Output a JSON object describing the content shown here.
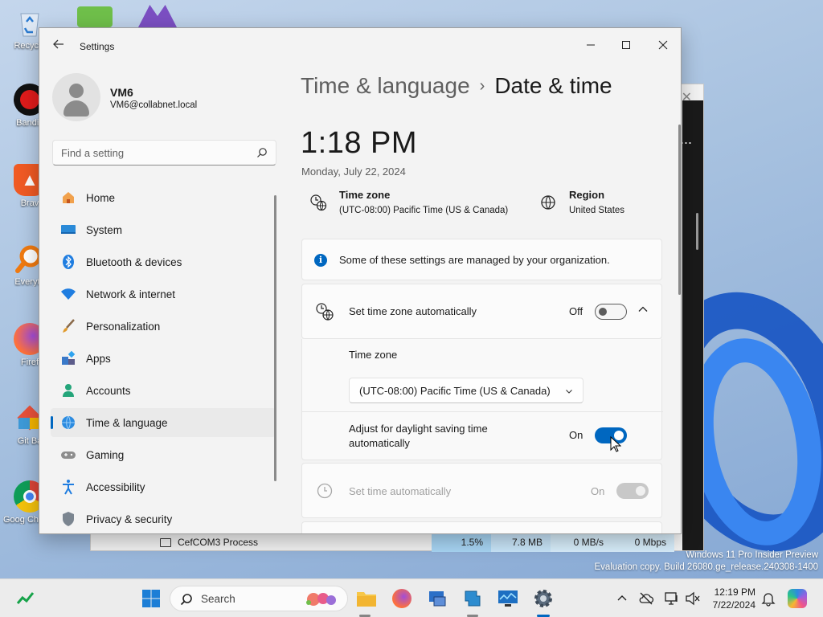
{
  "desktop": {
    "icons": [
      {
        "label": "Recycle",
        "icon": "recycle-bin-icon"
      },
      {
        "label": "Bandic",
        "icon": "bandicam-icon"
      },
      {
        "label": "Brav",
        "icon": "brave-browser-icon"
      },
      {
        "label": "Everyth",
        "icon": "everything-search-icon"
      },
      {
        "label": "Firef",
        "icon": "firefox-icon"
      },
      {
        "label": "Git Ba",
        "icon": "git-bash-icon"
      },
      {
        "label": "Goog Chrome",
        "icon": "google-chrome-icon"
      }
    ],
    "watermark": {
      "line1": "Windows 11 Pro Insider Preview",
      "line2": "Evaluation copy. Build 26080.ge_release.240308-1400"
    }
  },
  "task_manager": {
    "process_row": {
      "name": "CefCOM3 Process",
      "cpu": "1.5%",
      "memory": "7.8 MB",
      "disk": "0 MB/s",
      "network": "0 Mbps"
    },
    "more_label": "..."
  },
  "settings": {
    "title": "Settings",
    "user": {
      "name": "VM6",
      "email": "VM6@collabnet.local"
    },
    "search": {
      "placeholder": "Find a setting"
    },
    "nav": [
      {
        "label": "Home",
        "icon": "home-icon",
        "active": false
      },
      {
        "label": "System",
        "icon": "system-display-icon",
        "active": false
      },
      {
        "label": "Bluetooth & devices",
        "icon": "bluetooth-icon",
        "active": false
      },
      {
        "label": "Network & internet",
        "icon": "wifi-icon",
        "active": false
      },
      {
        "label": "Personalization",
        "icon": "brush-icon",
        "active": false
      },
      {
        "label": "Apps",
        "icon": "apps-icon",
        "active": false
      },
      {
        "label": "Accounts",
        "icon": "accounts-icon",
        "active": false
      },
      {
        "label": "Time & language",
        "icon": "globe-clock-icon",
        "active": true
      },
      {
        "label": "Gaming",
        "icon": "gamepad-icon",
        "active": false
      },
      {
        "label": "Accessibility",
        "icon": "accessibility-icon",
        "active": false
      },
      {
        "label": "Privacy & security",
        "icon": "shield-icon",
        "active": false
      }
    ],
    "breadcrumb": {
      "parent": "Time & language",
      "separator": "›",
      "current": "Date & time"
    },
    "clock": {
      "time": "1:18 PM",
      "date": "Monday, July 22, 2024"
    },
    "time_zone_info": {
      "label": "Time zone",
      "value": "(UTC-08:00) Pacific Time (US & Canada)"
    },
    "region_info": {
      "label": "Region",
      "value": "United States"
    },
    "notice": "Some of these settings are managed by your organization.",
    "set_tz_auto": {
      "label": "Set time zone automatically",
      "state": "Off"
    },
    "time_zone_select": {
      "label": "Time zone",
      "value": "(UTC-08:00) Pacific Time (US & Canada)"
    },
    "daylight_saving": {
      "label_line1": "Adjust for daylight saving time",
      "label_line2": "automatically",
      "state": "On"
    },
    "set_time_auto": {
      "label": "Set time automatically",
      "state": "On"
    }
  },
  "taskbar": {
    "search_label": "Search",
    "clock_time": "12:19 PM",
    "clock_date": "7/22/2024",
    "accent": "#0067c0"
  }
}
